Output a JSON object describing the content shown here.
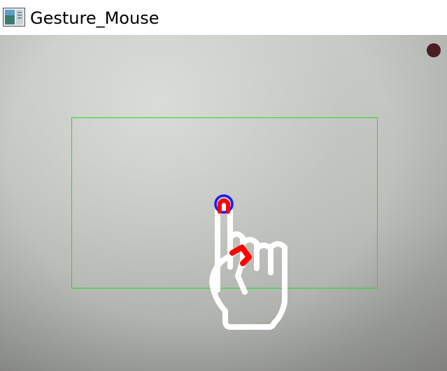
{
  "window": {
    "title": "Gesture_Mouse"
  },
  "icons": {
    "app": "app-window-icon",
    "status": "status-dot",
    "hand": "pointing-hand-icon"
  },
  "colors": {
    "tracking_box": "#22dd22",
    "fingertip_ring": "#1a1aff",
    "fingertip_fill": "#ff0000",
    "hand_outline": "#ffffff",
    "status_dot": "#4a1c24"
  }
}
